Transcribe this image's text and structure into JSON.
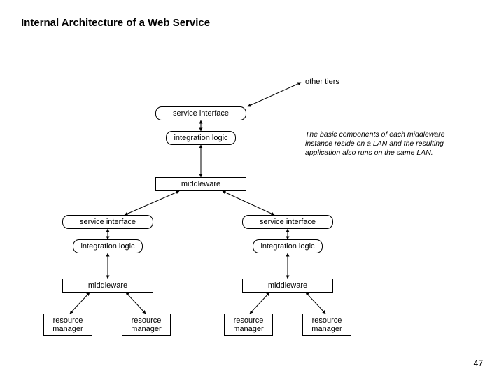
{
  "title": "Internal Architecture of a Web Service",
  "labels": {
    "other_tiers": "other tiers",
    "service_interface": "service interface",
    "integration_logic": "integration logic",
    "middleware": "middleware",
    "resource_manager": "resource\nmanager"
  },
  "note": "The basic components of each middleware instance reside on a LAN and the resulting application also runs on the same LAN.",
  "page_number": "47"
}
